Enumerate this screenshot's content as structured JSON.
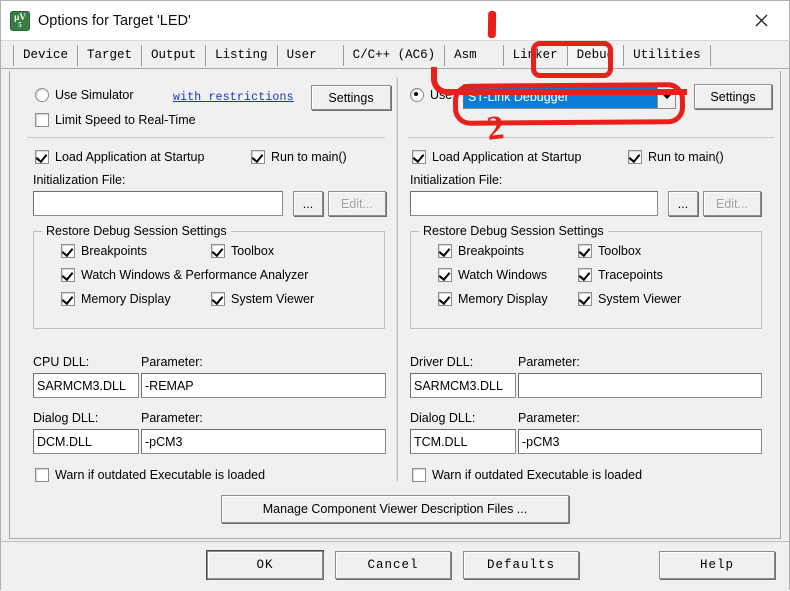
{
  "window": {
    "title": "Options for Target 'LED'",
    "icon": "uvision-icon",
    "close_label": "✕"
  },
  "tabs": [
    {
      "label": "Device",
      "active": false
    },
    {
      "label": "Target",
      "active": false
    },
    {
      "label": "Output",
      "active": false
    },
    {
      "label": "Listing",
      "active": false
    },
    {
      "label": "User",
      "active": false
    },
    {
      "label": "C/C++ (AC6)",
      "active": false
    },
    {
      "label": "Asm",
      "active": false
    },
    {
      "label": "Linker",
      "active": false
    },
    {
      "label": "Debug",
      "active": true
    },
    {
      "label": "Utilities",
      "active": false
    }
  ],
  "left": {
    "use_simulator_label": "Use Simulator",
    "use_simulator_checked": false,
    "restrictions_link": "with restrictions",
    "settings_button": "Settings",
    "limit_speed_label": "Limit Speed to Real-Time",
    "limit_speed_checked": false,
    "load_app_label": "Load Application at Startup",
    "load_app_checked": true,
    "run_to_main_label": "Run to main()",
    "run_to_main_checked": true,
    "init_file_label": "Initialization File:",
    "init_file_value": "",
    "browse_button": "...",
    "edit_button": "Edit...",
    "edit_button_disabled": true,
    "restore_group_title": "Restore Debug Session Settings",
    "restore_items": [
      {
        "label": "Breakpoints",
        "checked": true
      },
      {
        "label": "Toolbox",
        "checked": true
      },
      {
        "label": "Watch Windows & Performance Analyzer",
        "checked": true
      },
      {
        "label": "Memory Display",
        "checked": true
      },
      {
        "label": "System Viewer",
        "checked": true
      }
    ],
    "cpu_dll_label": "CPU DLL:",
    "cpu_dll_value": "SARMCM3.DLL",
    "cpu_param_label": "Parameter:",
    "cpu_param_value": "-REMAP",
    "dialog_dll_label": "Dialog DLL:",
    "dialog_dll_value": "DCM.DLL",
    "dialog_param_label": "Parameter:",
    "dialog_param_value": "-pCM3",
    "warn_label": "Warn if outdated Executable is loaded",
    "warn_checked": false
  },
  "right": {
    "use_label": "Use",
    "use_checked": true,
    "debugger_value": "ST-Link Debugger",
    "settings_button": "Settings",
    "load_app_label": "Load Application at Startup",
    "load_app_checked": true,
    "run_to_main_label": "Run to main()",
    "run_to_main_checked": true,
    "init_file_label": "Initialization File:",
    "init_file_value": "",
    "browse_button": "...",
    "edit_button": "Edit...",
    "edit_button_disabled": true,
    "restore_group_title": "Restore Debug Session Settings",
    "restore_items": [
      {
        "label": "Breakpoints",
        "checked": true
      },
      {
        "label": "Toolbox",
        "checked": true
      },
      {
        "label": "Watch Windows",
        "checked": true
      },
      {
        "label": "Tracepoints",
        "checked": true
      },
      {
        "label": "Memory Display",
        "checked": true
      },
      {
        "label": "System Viewer",
        "checked": true
      }
    ],
    "driver_dll_label": "Driver DLL:",
    "driver_dll_value": "SARMCM3.DLL",
    "driver_param_label": "Parameter:",
    "driver_param_value": "",
    "dialog_dll_label": "Dialog DLL:",
    "dialog_dll_value": "TCM.DLL",
    "dialog_param_label": "Parameter:",
    "dialog_param_value": "-pCM3",
    "warn_label": "Warn if outdated Executable is loaded",
    "warn_checked": false
  },
  "manage_button": "Manage Component Viewer Description Files ...",
  "footer": {
    "ok": "OK",
    "cancel": "Cancel",
    "defaults": "Defaults",
    "help": "Help"
  },
  "annotations": {
    "mark_one": "1",
    "mark_two": "2",
    "color": "#e8201b"
  }
}
